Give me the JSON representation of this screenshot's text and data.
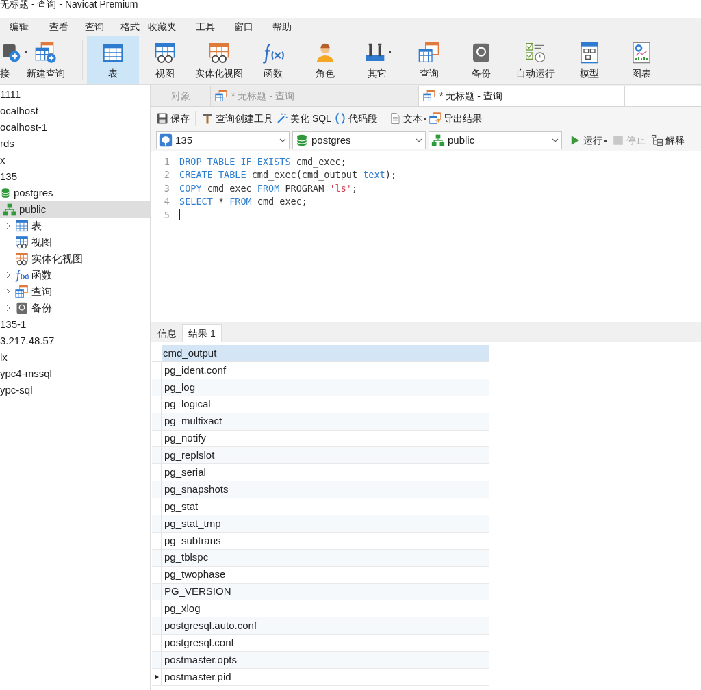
{
  "window": {
    "title": "无标题 - 查询 - Navicat Premium"
  },
  "menu": [
    "编辑",
    "查看",
    "查询",
    "格式",
    "收藏夹",
    "工具",
    "窗口",
    "帮助"
  ],
  "toolbar": [
    {
      "label": "接",
      "kind": "connection",
      "selected": false,
      "dropdown": true
    },
    {
      "label": "新建查询",
      "kind": "new-query",
      "selected": false,
      "dropdown": false
    },
    {
      "label": "表",
      "kind": "table",
      "selected": true,
      "dropdown": false
    },
    {
      "label": "视图",
      "kind": "view",
      "selected": false,
      "dropdown": false
    },
    {
      "label": "实体化视图",
      "kind": "matview",
      "selected": false,
      "dropdown": false
    },
    {
      "label": "函数",
      "kind": "function",
      "selected": false,
      "dropdown": false
    },
    {
      "label": "角色",
      "kind": "user",
      "selected": false,
      "dropdown": false
    },
    {
      "label": "其它",
      "kind": "tools",
      "selected": false,
      "dropdown": true
    },
    {
      "label": "查询",
      "kind": "query",
      "selected": false,
      "dropdown": false
    },
    {
      "label": "备份",
      "kind": "backup",
      "selected": false,
      "dropdown": false
    },
    {
      "label": "自动运行",
      "kind": "schedule",
      "selected": false,
      "dropdown": false
    },
    {
      "label": "模型",
      "kind": "model",
      "selected": false,
      "dropdown": false
    },
    {
      "label": "图表",
      "kind": "chart",
      "selected": false,
      "dropdown": false
    }
  ],
  "sidebar": {
    "items": [
      {
        "label": "1111"
      },
      {
        "label": "ocalhost"
      },
      {
        "label": "ocalhost-1"
      },
      {
        "label": "rds"
      },
      {
        "label": "x"
      },
      {
        "label": "135",
        "children": [
          {
            "label": "postgres",
            "kind": "database",
            "children": [
              {
                "label": "public",
                "kind": "schema",
                "selected": true,
                "children": [
                  {
                    "label": "表",
                    "kind": "table",
                    "expanded": false
                  },
                  {
                    "label": "视图",
                    "kind": "view"
                  },
                  {
                    "label": "实体化视图",
                    "kind": "matview"
                  },
                  {
                    "label": "函数",
                    "kind": "function",
                    "expanded": false
                  },
                  {
                    "label": "查询",
                    "kind": "query",
                    "expanded": false
                  },
                  {
                    "label": "备份",
                    "kind": "backup",
                    "expanded": false
                  }
                ]
              }
            ]
          }
        ]
      },
      {
        "label": "135-1"
      },
      {
        "label": "3.217.48.57"
      },
      {
        "label": "lx"
      },
      {
        "label": "ypc4-mssql"
      },
      {
        "label": "ypc-sql"
      }
    ]
  },
  "editor_tabs": [
    {
      "label": "对象",
      "kind": "objects",
      "selected": false
    },
    {
      "label": "* 无标题 - 查询",
      "kind": "query",
      "selected": false
    },
    {
      "label": "* 无标题 - 查询",
      "kind": "query",
      "selected": true
    }
  ],
  "query_toolbar": [
    {
      "label": "保存",
      "kind": "save",
      "dropdown": false
    },
    {
      "label": "查询创建工具",
      "kind": "builder",
      "dropdown": false
    },
    {
      "label": "美化 SQL",
      "kind": "beautify",
      "dropdown": false
    },
    {
      "label": "代码段",
      "kind": "snippet",
      "dropdown": false
    },
    {
      "label": "文本",
      "kind": "text",
      "dropdown": true
    },
    {
      "label": "导出结果",
      "kind": "export",
      "dropdown": false
    }
  ],
  "selectors": [
    {
      "value": "135",
      "kind": "connection"
    },
    {
      "value": "postgres",
      "kind": "database"
    },
    {
      "value": "public",
      "kind": "schema"
    }
  ],
  "run_buttons": [
    {
      "label": "运行",
      "kind": "run",
      "disabled": false,
      "dropdown": true
    },
    {
      "label": "停止",
      "kind": "stop",
      "disabled": true,
      "dropdown": false
    },
    {
      "label": "解释",
      "kind": "explain",
      "disabled": false,
      "dropdown": false
    }
  ],
  "sql_lines": [
    {
      "number": "1",
      "tokens": [
        {
          "text": "DROP TABLE IF EXISTS",
          "kind": "keyword"
        },
        {
          "text": " cmd_exec;",
          "kind": "plain"
        }
      ]
    },
    {
      "number": "2",
      "tokens": [
        {
          "text": "CREATE TABLE",
          "kind": "keyword"
        },
        {
          "text": " cmd_exec(cmd_output ",
          "kind": "plain"
        },
        {
          "text": "text",
          "kind": "keyword"
        },
        {
          "text": ");",
          "kind": "plain"
        }
      ]
    },
    {
      "number": "3",
      "tokens": [
        {
          "text": "COPY",
          "kind": "keyword"
        },
        {
          "text": " cmd_exec ",
          "kind": "plain"
        },
        {
          "text": "FROM",
          "kind": "keyword"
        },
        {
          "text": " PROGRAM ",
          "kind": "plain"
        },
        {
          "text": "'ls'",
          "kind": "string"
        },
        {
          "text": ";",
          "kind": "plain"
        }
      ]
    },
    {
      "number": "4",
      "tokens": [
        {
          "text": "SELECT",
          "kind": "keyword"
        },
        {
          "text": " * ",
          "kind": "plain"
        },
        {
          "text": "FROM",
          "kind": "keyword"
        },
        {
          "text": " cmd_exec;",
          "kind": "plain"
        }
      ]
    },
    {
      "number": "5",
      "caret": true
    }
  ],
  "result_tabs": [
    {
      "label": "信息",
      "selected": false
    },
    {
      "label": "结果 1",
      "selected": true
    }
  ],
  "table": {
    "columns": [
      "cmd_output"
    ],
    "rows": [
      {
        "cells": [
          "pg_ident.conf"
        ],
        "current": false
      },
      {
        "cells": [
          "pg_log"
        ],
        "current": false
      },
      {
        "cells": [
          "pg_logical"
        ],
        "current": false
      },
      {
        "cells": [
          "pg_multixact"
        ],
        "current": false
      },
      {
        "cells": [
          "pg_notify"
        ],
        "current": false
      },
      {
        "cells": [
          "pg_replslot"
        ],
        "current": false
      },
      {
        "cells": [
          "pg_serial"
        ],
        "current": false
      },
      {
        "cells": [
          "pg_snapshots"
        ],
        "current": false
      },
      {
        "cells": [
          "pg_stat"
        ],
        "current": false
      },
      {
        "cells": [
          "pg_stat_tmp"
        ],
        "current": false
      },
      {
        "cells": [
          "pg_subtrans"
        ],
        "current": false
      },
      {
        "cells": [
          "pg_tblspc"
        ],
        "current": false
      },
      {
        "cells": [
          "pg_twophase"
        ],
        "current": false
      },
      {
        "cells": [
          "PG_VERSION"
        ],
        "current": false
      },
      {
        "cells": [
          "pg_xlog"
        ],
        "current": false
      },
      {
        "cells": [
          "postgresql.auto.conf"
        ],
        "current": false
      },
      {
        "cells": [
          "postgresql.conf"
        ],
        "current": false
      },
      {
        "cells": [
          "postmaster.opts"
        ],
        "current": false
      },
      {
        "cells": [
          "postmaster.pid"
        ],
        "current": true
      }
    ]
  }
}
